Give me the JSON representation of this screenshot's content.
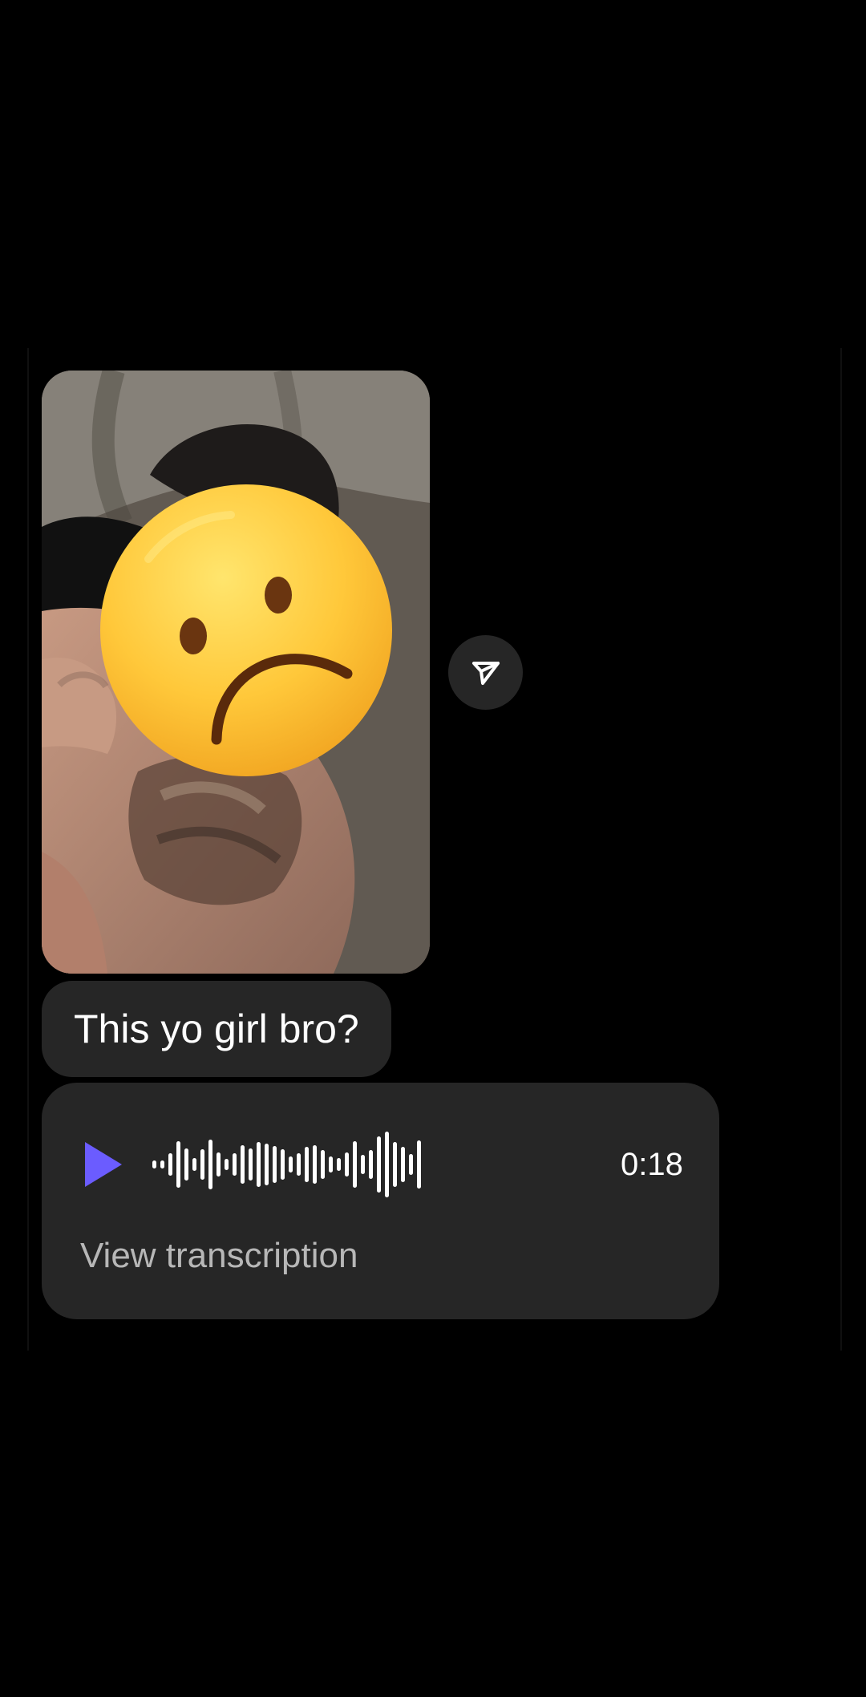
{
  "messages": {
    "photo": {
      "icon": "sad-face-emoji-icon"
    },
    "share": {
      "icon": "send-icon"
    },
    "text": {
      "body": "This yo girl bro?"
    },
    "voice": {
      "duration": "0:18",
      "transcription_label": "View transcription",
      "play_icon": "play-icon",
      "accent": "#6b5cff"
    }
  },
  "colors": {
    "background": "#000000",
    "bubble": "#262626",
    "text": "#ffffff",
    "secondary_text": "#b7b7b7"
  }
}
